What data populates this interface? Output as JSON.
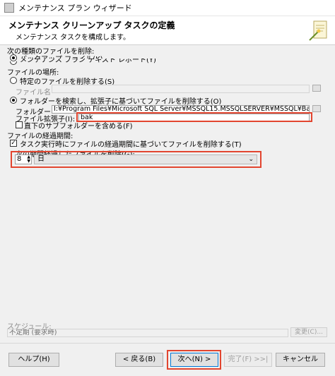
{
  "window": {
    "title": "メンテナンス プラン ウィザード"
  },
  "header": {
    "title": "メンテナンス クリーンアップ タスクの定義",
    "subtitle": "メンテナンス タスクを構成します。"
  },
  "delete_type": {
    "label": "次の種類のファイルを削除:",
    "option_backup": "バックアップ ファイル(K)",
    "option_report": "メンテナンス プラン テキスト レポート(Y)"
  },
  "file_location": {
    "label": "ファイルの場所:",
    "option_specific": "特定のファイルを削除する(S)",
    "file_name_label": "ファイル名",
    "option_folder": "フォルダーを検索し、拡張子に基づいてファイルを削除する(O)",
    "folder_label": "フォルダー",
    "folder_value": "I:¥Program Files¥Microsoft SQL Server¥MSSQL15.MSSQLSERVER¥MSSQL¥Backup",
    "extension_label": "ファイル拡張子(I):",
    "extension_value": "bak",
    "subfolder_label": "直下のサブフォルダーを含める(F)"
  },
  "file_age": {
    "label": "ファイルの経過期間:",
    "check_label": "タスク実行時にファイルの経過期間に基づいてファイルを削除する(T)",
    "older_than_label": "次の期間経過したファイルを削除(G):",
    "number_value": "8",
    "unit_value": "日"
  },
  "schedule": {
    "label": "スケジュール:",
    "value": "不定期 (要求時)",
    "change_button": "変更(C)..."
  },
  "footer": {
    "help": "ヘルプ(H)",
    "back": "< 戻る(B)",
    "next": "次へ(N) >",
    "finish": "完了(F) >>|",
    "cancel": "キャンセル"
  },
  "colors": {
    "highlight": "#e2452f",
    "primary_border": "#0078d7"
  },
  "icons": {
    "app": "maintenance-plan-icon",
    "wizard": "wizard-document-icon"
  }
}
